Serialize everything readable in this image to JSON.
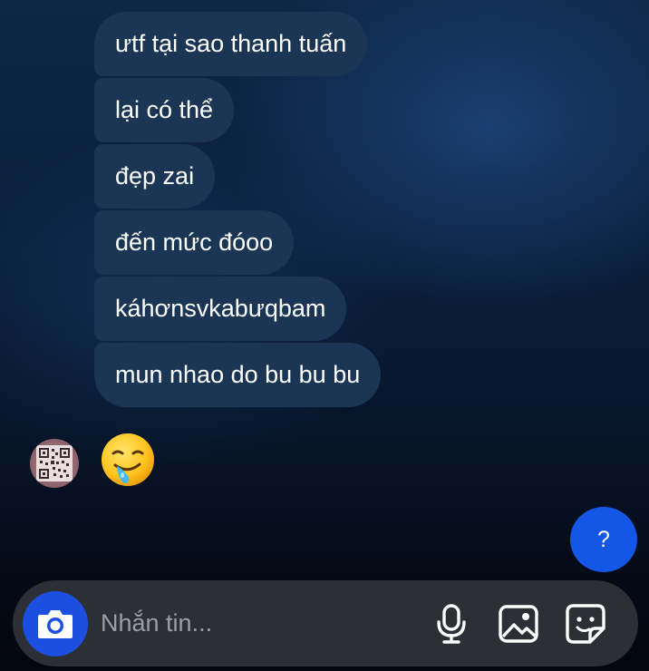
{
  "messages": [
    "ưtf tại sao thanh tuấn",
    "lại có thể",
    "đẹp zai",
    "đến mức đóoo",
    "káhơnsvkabưqbam",
    "mun nhao do bu bu bu"
  ],
  "reply": {
    "emoji": "drooling-face"
  },
  "help_button": {
    "label": "?"
  },
  "composer": {
    "placeholder": "Nhắn tin..."
  },
  "colors": {
    "bubble": "#1a3654",
    "accent": "#1456e6",
    "composer_bg": "#2c2f36"
  }
}
